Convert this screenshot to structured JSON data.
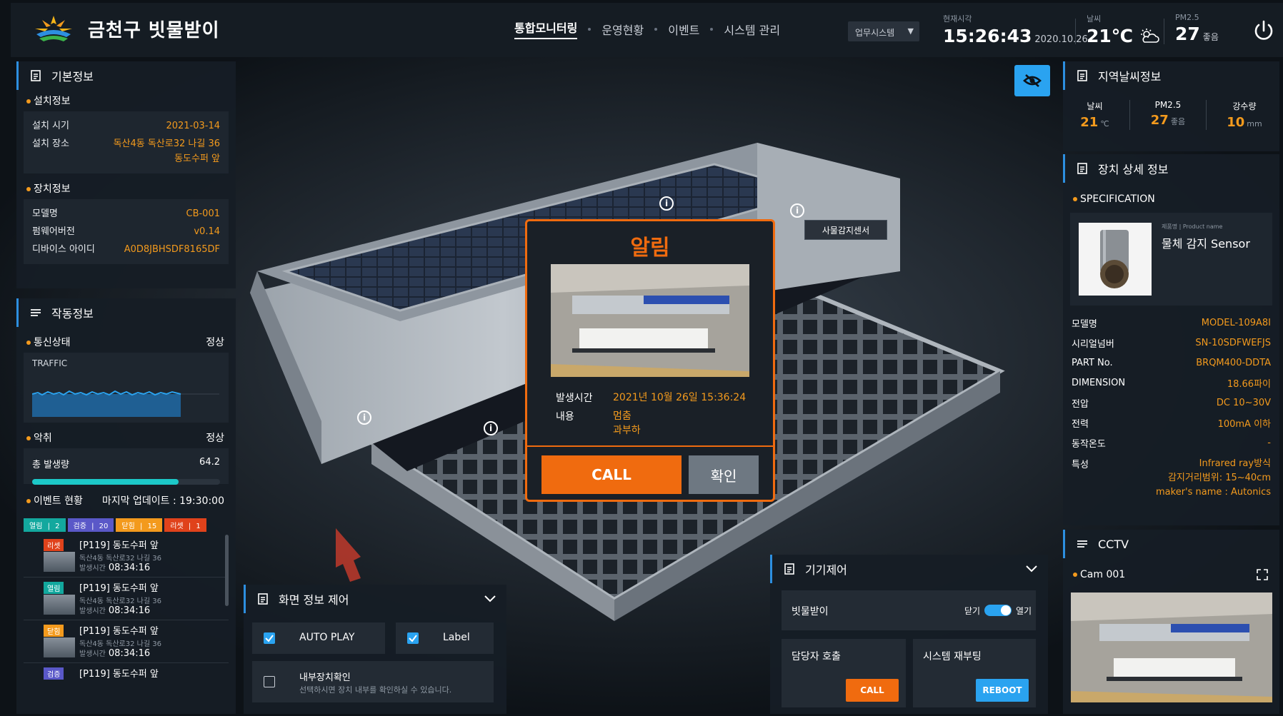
{
  "header": {
    "app_title": "금천구 빗물받이",
    "nav": [
      {
        "label": "통합모니터링",
        "active": true
      },
      {
        "label": "운영현황"
      },
      {
        "label": "이벤트"
      },
      {
        "label": "시스템 관리"
      }
    ],
    "system_select": "업무시스템",
    "time_label": "현재시각",
    "time": "15:26:43",
    "date": "2020.10.26",
    "weather_label": "날씨",
    "weather_value": "21℃",
    "pm_label": "PM2.5",
    "pm_value": "27",
    "pm_status": "좋음"
  },
  "left": {
    "basic_title": "기본정보",
    "install_title": "설치정보",
    "install": [
      {
        "k": "설치 시기",
        "v": "2021-03-14"
      },
      {
        "k": "설치 장소",
        "v": "독산4동 독산로32 나길 36",
        "v2": "동도수퍼 앞"
      }
    ],
    "device_title": "장치정보",
    "device": [
      {
        "k": "모델명",
        "v": "CB-001"
      },
      {
        "k": "펌웨어버전",
        "v": "v0.14"
      },
      {
        "k": "디바이스 아이디",
        "v": "A0D8JBHSDF8165DF"
      }
    ],
    "op_title": "작동정보",
    "comm_label": "통신상태",
    "comm_status": "정상",
    "traffic_label": "TRAFFIC",
    "odor_label": "악취",
    "odor_status": "정상",
    "odor_total_label": "총 발생량",
    "odor_total": "64.2",
    "odor_fill_pct": 78,
    "event_label": "이벤트 현황",
    "last_update": "마지막 업데이트 : 19:30:00",
    "legend": [
      {
        "label": "열림",
        "count": "2",
        "color": "#13a89e"
      },
      {
        "label": "검증",
        "count": "20",
        "color": "#5a58c8"
      },
      {
        "label": "닫힘",
        "count": "15",
        "color": "#f39a1d"
      },
      {
        "label": "리셋",
        "count": "1",
        "color": "#e0421b"
      }
    ],
    "events": [
      {
        "tag": "리셋",
        "color": "#e0421b",
        "name": "[P119] 동도수퍼 앞",
        "addr": "독산4동 독산로32 나길 36",
        "tm_label": "발생시간",
        "tm": "08:34:16"
      },
      {
        "tag": "열림",
        "color": "#13a89e",
        "name": "[P119] 동도수퍼 앞",
        "addr": "독산4동 독산로32 나길 36",
        "tm_label": "발생시간",
        "tm": "08:34:16"
      },
      {
        "tag": "닫힘",
        "color": "#f39a1d",
        "name": "[P119] 동도수퍼 앞",
        "addr": "독산4동 독산로32 나길 36",
        "tm_label": "발생시간",
        "tm": "08:34:16"
      },
      {
        "tag": "검증",
        "color": "#5a58c8",
        "name": "[P119] 동도수퍼 앞",
        "addr": "",
        "tm_label": "",
        "tm": ""
      }
    ]
  },
  "alert": {
    "title": "알림",
    "time_label": "발생시간",
    "time_value": "2021년 10월 26일 15:36:24",
    "content_label": "내용",
    "content_1": "멈춤",
    "content_2": "과부하",
    "call_label": "CALL",
    "ok_label": "확인"
  },
  "scene": {
    "sensor_tag": "사물감지센서"
  },
  "screen_ctrl": {
    "title": "화면 정보 제어",
    "autoplay": "AUTO PLAY",
    "label": "Label",
    "inner_title": "내부장치확인",
    "inner_desc": "선택하시면 장치 내부를 확인하실 수 있습니다."
  },
  "device_ctrl": {
    "title": "기기제어",
    "gully_label": "빗물받이",
    "close_label": "닫기",
    "open_label": "열기",
    "manager_label": "담당자 호출",
    "call_label": "CALL",
    "reboot_title": "시스템 재부팅",
    "reboot_label": "REBOOT"
  },
  "right": {
    "weather_title": "지역날씨정보",
    "wx": [
      {
        "l": "날씨",
        "v": "21",
        "u": "℃"
      },
      {
        "l": "PM2.5",
        "v": "27",
        "u": "좋음"
      },
      {
        "l": "강수량",
        "v": "10",
        "u": "mm"
      }
    ],
    "detail_title": "장치 상세 정보",
    "spec_label": "SPECIFICATION",
    "product_caption": "제품명 | Product name",
    "product_name": "물체 감지 Sensor",
    "specs": [
      {
        "k": "모델명",
        "v": "MODEL-109A8I"
      },
      {
        "k": "시리얼넘버",
        "v": "SN-10SDFWEFJS"
      },
      {
        "k": "PART No.",
        "v": "BRQM400-DDTA"
      },
      {
        "k": "DIMENSION",
        "v": "18.66파이"
      },
      {
        "k": "전압",
        "v": "DC 10~30V"
      },
      {
        "k": "전력",
        "v": "100mA 이하"
      },
      {
        "k": "동작온도",
        "v": "-"
      }
    ],
    "feature_k": "특성",
    "feature_1": "Infrared ray방식",
    "feature_2": "감지거리범위: 15~40cm",
    "feature_3": "maker's name : Autonics",
    "cctv_title": "CCTV",
    "cam_label": "Cam 001"
  },
  "colors": {
    "accent": "#f06b0f",
    "highlight": "#f39a1d",
    "blue": "#2aa3f0",
    "teal": "#1cc8c8"
  }
}
